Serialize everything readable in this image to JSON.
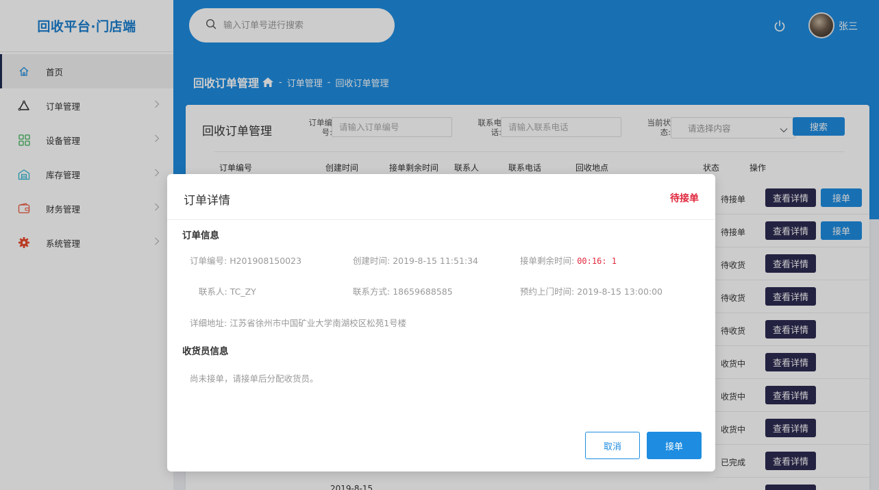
{
  "app": {
    "title": "回收平台·门店端"
  },
  "header": {
    "search_placeholder": "输入订单号进行搜索",
    "username": "张三"
  },
  "sidebar": {
    "items": [
      {
        "label": "首页",
        "icon": "home-icon",
        "active": true
      },
      {
        "label": "订单管理",
        "icon": "triangle-icon"
      },
      {
        "label": "设备管理",
        "icon": "grid-icon"
      },
      {
        "label": "库存管理",
        "icon": "warehouse-icon"
      },
      {
        "label": "财务管理",
        "icon": "wallet-icon"
      },
      {
        "label": "系统管理",
        "icon": "gear-icon"
      }
    ]
  },
  "breadcrumb": {
    "title": "回收订单管理",
    "sep": "-",
    "parts": [
      "订单管理",
      "回收订单管理"
    ]
  },
  "card": {
    "title": "回收订单管理",
    "filters": {
      "order_label": "订单编号:",
      "order_placeholder": "请输入订单编号",
      "phone_label": "联系电话:",
      "phone_placeholder": "请输入联系电话",
      "status_label": "当前状态:",
      "status_placeholder": "请选择内容",
      "search_button": "搜索"
    },
    "columns": [
      "订单编号",
      "创建时间",
      "接单剩余时间",
      "联系人",
      "联系电话",
      "回收地点",
      "状态",
      "操作"
    ],
    "rows": [
      {
        "status": "待接单",
        "detail": "查看详情",
        "accept": "接单"
      },
      {
        "status": "待接单",
        "detail": "查看详情",
        "accept": "接单"
      },
      {
        "status": "待收货",
        "detail": "查看详情"
      },
      {
        "status": "待收货",
        "detail": "查看详情"
      },
      {
        "status": "待收货",
        "detail": "查看详情"
      },
      {
        "status": "收货中",
        "detail": "查看详情"
      },
      {
        "status": "收货中",
        "detail": "查看详情"
      },
      {
        "status": "收货中",
        "detail": "查看详情"
      },
      {
        "status": "已完成",
        "detail": "查看详情"
      }
    ],
    "peek_date": "2019-8-15"
  },
  "modal": {
    "title": "订单详情",
    "status": "待接单",
    "order_section": "订单信息",
    "fields": {
      "order_no_label": "订单编号:",
      "order_no": "H201908150023",
      "created_label": "创建时间:",
      "created": "2019-8-15 11:51:34",
      "remaining_label": "接单剩余时间:",
      "remaining": "00:16: 1",
      "contact_label": "联系人:",
      "contact": "TC_ZY",
      "phone_label": "联系方式:",
      "phone": "18659688585",
      "visit_label": "预约上门时间:",
      "visit": "2019-8-15 13:00:00",
      "address_label": "详细地址:",
      "address": "江苏省徐州市中国矿业大学南湖校区松苑1号楼"
    },
    "receiver_section": "收货员信息",
    "receiver_note": "尚未接单，请接单后分配收货员。",
    "cancel_button": "取消",
    "accept_button": "接单"
  },
  "colors": {
    "brand_blue": "#1e8ce0",
    "dark_button": "#2d2b52",
    "status_red": "#e0283c"
  }
}
